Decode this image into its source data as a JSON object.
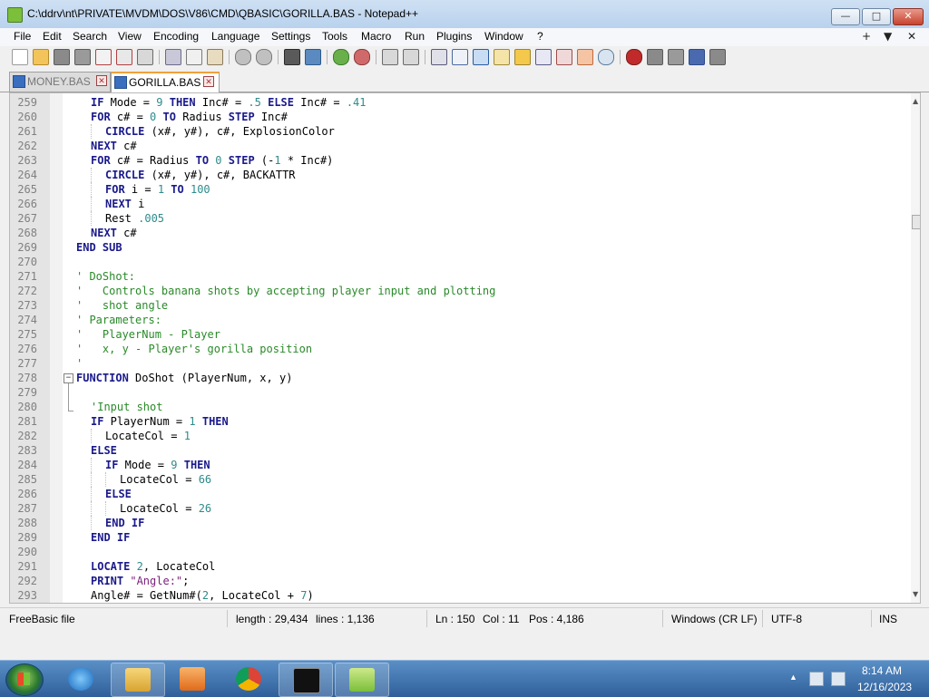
{
  "window": {
    "title": "C:\\ddrv\\nt\\PRIVATE\\MVDM\\DOS\\V86\\CMD\\QBASIC\\GORILLA.BAS - Notepad++",
    "minimize_label": "—",
    "maximize_label": "□",
    "close_label": "✕"
  },
  "menu": {
    "items": [
      "File",
      "Edit",
      "Search",
      "View",
      "Encoding",
      "Language",
      "Settings",
      "Tools",
      "Macro",
      "Run",
      "Plugins",
      "Window",
      "?"
    ],
    "right": [
      "+",
      "▼",
      "✕"
    ]
  },
  "toolbar": {
    "icons": [
      "new-file",
      "open-file",
      "save",
      "save-all",
      "close",
      "close-all",
      "print",
      "cut",
      "copy",
      "paste",
      "undo",
      "redo",
      "find",
      "replace",
      "zoom-in",
      "zoom-out",
      "sync-vertical",
      "sync-horizontal",
      "word-wrap",
      "show-all-chars",
      "indent-guide",
      "user-defined-language",
      "document-map",
      "function-list",
      "folder-as-workspace",
      "monitoring",
      "record-macro",
      "stop-recording",
      "playback-macro",
      "run-macro-multiple",
      "save-macro"
    ]
  },
  "tabs": [
    {
      "label": "MONEY.BAS",
      "active": false
    },
    {
      "label": "GORILLA.BAS",
      "active": true
    }
  ],
  "editor": {
    "lines": [
      {
        "num": "259",
        "indent": 2,
        "tokens": [
          [
            "kw",
            "IF"
          ],
          [
            "op",
            " Mode = "
          ],
          [
            "num",
            "9"
          ],
          [
            "op",
            " "
          ],
          [
            "kw",
            "THEN"
          ],
          [
            "op",
            " Inc# = "
          ],
          [
            "num",
            ".5"
          ],
          [
            "op",
            " "
          ],
          [
            "kw",
            "ELSE"
          ],
          [
            "op",
            " Inc# = "
          ],
          [
            "num",
            ".41"
          ]
        ]
      },
      {
        "num": "260",
        "indent": 2,
        "tokens": [
          [
            "kw",
            "FOR"
          ],
          [
            "op",
            " c# = "
          ],
          [
            "num",
            "0"
          ],
          [
            "op",
            " "
          ],
          [
            "kw",
            "TO"
          ],
          [
            "op",
            " Radius "
          ],
          [
            "kw",
            "STEP"
          ],
          [
            "op",
            " Inc#"
          ]
        ]
      },
      {
        "num": "261",
        "indent": 3,
        "tokens": [
          [
            "kw",
            "CIRCLE"
          ],
          [
            "op",
            " (x#, y#), c#, ExplosionColor"
          ]
        ]
      },
      {
        "num": "262",
        "indent": 2,
        "tokens": [
          [
            "kw",
            "NEXT"
          ],
          [
            "op",
            " c#"
          ]
        ]
      },
      {
        "num": "263",
        "indent": 2,
        "tokens": [
          [
            "kw",
            "FOR"
          ],
          [
            "op",
            " c# = Radius "
          ],
          [
            "kw",
            "TO"
          ],
          [
            "op",
            " "
          ],
          [
            "num",
            "0"
          ],
          [
            "op",
            " "
          ],
          [
            "kw",
            "STEP"
          ],
          [
            "op",
            " (-"
          ],
          [
            "num",
            "1"
          ],
          [
            "op",
            " * Inc#)"
          ]
        ]
      },
      {
        "num": "264",
        "indent": 3,
        "tokens": [
          [
            "kw",
            "CIRCLE"
          ],
          [
            "op",
            " (x#, y#), c#, BACKATTR"
          ]
        ]
      },
      {
        "num": "265",
        "indent": 3,
        "tokens": [
          [
            "kw",
            "FOR"
          ],
          [
            "op",
            " i = "
          ],
          [
            "num",
            "1"
          ],
          [
            "op",
            " "
          ],
          [
            "kw",
            "TO"
          ],
          [
            "op",
            " "
          ],
          [
            "num",
            "100"
          ]
        ]
      },
      {
        "num": "266",
        "indent": 3,
        "tokens": [
          [
            "kw",
            "NEXT"
          ],
          [
            "op",
            " i"
          ]
        ]
      },
      {
        "num": "267",
        "indent": 3,
        "tokens": [
          [
            "op",
            "Rest "
          ],
          [
            "num",
            ".005"
          ]
        ]
      },
      {
        "num": "268",
        "indent": 2,
        "tokens": [
          [
            "kw",
            "NEXT"
          ],
          [
            "op",
            " c#"
          ]
        ]
      },
      {
        "num": "269",
        "indent": 1,
        "tokens": [
          [
            "kw",
            "END SUB"
          ]
        ]
      },
      {
        "num": "270",
        "indent": 1,
        "tokens": []
      },
      {
        "num": "271",
        "indent": 1,
        "tokens": [
          [
            "cmt",
            "' DoShot:"
          ]
        ]
      },
      {
        "num": "272",
        "indent": 1,
        "tokens": [
          [
            "cmt",
            "'   Controls banana shots by accepting player input and plotting"
          ]
        ]
      },
      {
        "num": "273",
        "indent": 1,
        "tokens": [
          [
            "cmt",
            "'   shot angle"
          ]
        ]
      },
      {
        "num": "274",
        "indent": 1,
        "tokens": [
          [
            "cmt",
            "' Parameters:"
          ]
        ]
      },
      {
        "num": "275",
        "indent": 1,
        "tokens": [
          [
            "cmt",
            "'   PlayerNum - Player"
          ]
        ]
      },
      {
        "num": "276",
        "indent": 1,
        "tokens": [
          [
            "cmt",
            "'   x, y - Player's gorilla position"
          ]
        ]
      },
      {
        "num": "277",
        "indent": 1,
        "tokens": [
          [
            "cmt",
            "'"
          ]
        ]
      },
      {
        "num": "278",
        "indent": 1,
        "tokens": [
          [
            "kw",
            "FUNCTION"
          ],
          [
            "op",
            " DoShot (PlayerNum, x, y)"
          ]
        ]
      },
      {
        "num": "279",
        "indent": 1,
        "tokens": []
      },
      {
        "num": "280",
        "indent": 2,
        "tokens": [
          [
            "cmt",
            "'Input shot"
          ]
        ]
      },
      {
        "num": "281",
        "indent": 2,
        "tokens": [
          [
            "kw",
            "IF"
          ],
          [
            "op",
            " PlayerNum = "
          ],
          [
            "num",
            "1"
          ],
          [
            "op",
            " "
          ],
          [
            "kw",
            "THEN"
          ]
        ]
      },
      {
        "num": "282",
        "indent": 3,
        "tokens": [
          [
            "op",
            "LocateCol = "
          ],
          [
            "num",
            "1"
          ]
        ]
      },
      {
        "num": "283",
        "indent": 2,
        "tokens": [
          [
            "kw",
            "ELSE"
          ]
        ]
      },
      {
        "num": "284",
        "indent": 3,
        "tokens": [
          [
            "kw",
            "IF"
          ],
          [
            "op",
            " Mode = "
          ],
          [
            "num",
            "9"
          ],
          [
            "op",
            " "
          ],
          [
            "kw",
            "THEN"
          ]
        ]
      },
      {
        "num": "285",
        "indent": 4,
        "tokens": [
          [
            "op",
            "LocateCol = "
          ],
          [
            "num",
            "66"
          ]
        ]
      },
      {
        "num": "286",
        "indent": 3,
        "tokens": [
          [
            "kw",
            "ELSE"
          ]
        ]
      },
      {
        "num": "287",
        "indent": 4,
        "tokens": [
          [
            "op",
            "LocateCol = "
          ],
          [
            "num",
            "26"
          ]
        ]
      },
      {
        "num": "288",
        "indent": 3,
        "tokens": [
          [
            "kw",
            "END IF"
          ]
        ]
      },
      {
        "num": "289",
        "indent": 2,
        "tokens": [
          [
            "kw",
            "END IF"
          ]
        ]
      },
      {
        "num": "290",
        "indent": 2,
        "tokens": []
      },
      {
        "num": "291",
        "indent": 2,
        "tokens": [
          [
            "kw",
            "LOCATE"
          ],
          [
            "op",
            " "
          ],
          [
            "num",
            "2"
          ],
          [
            "op",
            ", LocateCol"
          ]
        ]
      },
      {
        "num": "292",
        "indent": 2,
        "tokens": [
          [
            "kw",
            "PRINT"
          ],
          [
            "op",
            " "
          ],
          [
            "str",
            "\"Angle:\""
          ],
          [
            "op",
            ";"
          ]
        ]
      },
      {
        "num": "293",
        "indent": 2,
        "tokens": [
          [
            "op",
            "Angle# = GetNum#("
          ],
          [
            "num",
            "2"
          ],
          [
            "op",
            ", LocateCol + "
          ],
          [
            "num",
            "7"
          ],
          [
            "op",
            ")"
          ]
        ]
      }
    ]
  },
  "status": {
    "file_type": "FreeBasic file",
    "length": "length : 29,434",
    "lines": "lines : 1,136",
    "ln": "Ln : 150",
    "col": "Col : 11",
    "pos": "Pos : 4,186",
    "eol": "Windows (CR LF)",
    "encoding": "UTF-8",
    "mode": "INS"
  },
  "taskbar": {
    "apps": [
      "internet-explorer",
      "file-explorer",
      "media-player",
      "chrome",
      "command-prompt",
      "notepad-plus-plus"
    ],
    "time": "8:14 AM",
    "date": "12/16/2023"
  },
  "colors": {
    "keyword": "#1a1a8c",
    "number": "#2e8b8b",
    "string": "#7a1f7a",
    "comment": "#2a8a2a",
    "active_tab_accent": "#f2a13b"
  }
}
